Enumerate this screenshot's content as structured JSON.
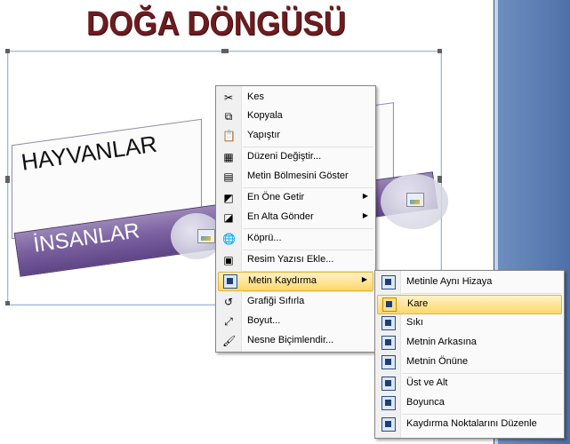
{
  "document": {
    "title": "DOĞA DÖNGÜSÜ",
    "diagram": {
      "card_label": "HAYVANLAR",
      "slab_label": "İNSANLAR"
    }
  },
  "context_menu": {
    "items": [
      {
        "label": "Kes",
        "icon": "scissors-icon",
        "glyph": "✂"
      },
      {
        "label": "Kopyala",
        "icon": "copy-icon",
        "glyph": "⧉"
      },
      {
        "label": "Yapıştır",
        "icon": "paste-icon",
        "glyph": "📋"
      },
      {
        "label": "Düzeni Değiştir...",
        "icon": "change-layout-icon",
        "glyph": "▦"
      },
      {
        "label": "Metin Bölmesini Göster",
        "icon": "text-pane-icon",
        "glyph": "▤"
      },
      {
        "label": "En Öne Getir",
        "icon": "bring-to-front-icon",
        "glyph": "◩"
      },
      {
        "label": "En Alta Gönder",
        "icon": "send-to-back-icon",
        "glyph": "◪"
      },
      {
        "label": "Köprü...",
        "icon": "hyperlink-icon",
        "glyph": "🌐"
      },
      {
        "label": "Resim Yazısı Ekle...",
        "icon": "caption-icon",
        "glyph": "▣"
      },
      {
        "label": "Metin Kaydırma",
        "icon": "text-wrap-icon",
        "glyph": ""
      },
      {
        "label": "Grafiği Sıfırla",
        "icon": "reset-graphic-icon",
        "glyph": "↺"
      },
      {
        "label": "Boyut...",
        "icon": "size-icon",
        "glyph": "⤢"
      },
      {
        "label": "Nesne Biçimlendir...",
        "icon": "format-object-icon",
        "glyph": "🖌"
      }
    ]
  },
  "wrap_submenu": {
    "items": [
      {
        "label": "Metinle Aynı Hizaya"
      },
      {
        "label": "Kare"
      },
      {
        "label": "Sıkı"
      },
      {
        "label": "Metnin Arkasına"
      },
      {
        "label": "Metnin Önüne"
      },
      {
        "label": "Üst ve Alt"
      },
      {
        "label": "Boyunca"
      },
      {
        "label": "Kaydırma Noktalarını Düzenle"
      }
    ],
    "selected": "Kare"
  },
  "colors": {
    "title": "#6b1c1f",
    "slab": "#7b61a0",
    "highlight": "#ffd86b"
  }
}
